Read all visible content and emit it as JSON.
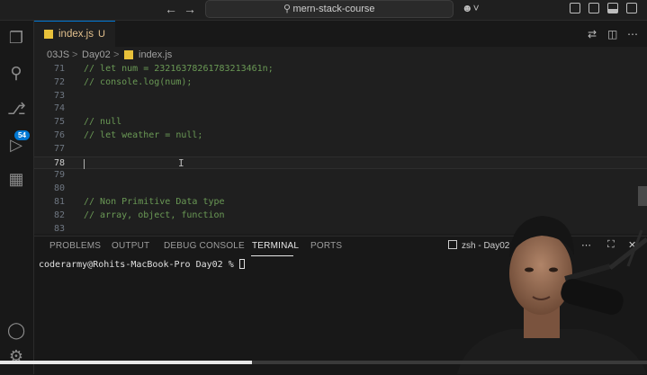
{
  "titlebar": {
    "back_icon": "arrow-left-icon",
    "forward_icon": "arrow-right-icon",
    "search_text": "mern-stack-course",
    "copilot_icon": "copilot-icon",
    "layout_icons": [
      "layout-panel-icon",
      "toggle-primary-sidebar-icon",
      "toggle-panel-icon",
      "toggle-secondary-sidebar-icon",
      "customize-layout-icon"
    ]
  },
  "activity_bar": {
    "items": [
      "explorer-icon",
      "search-icon",
      "source-control-icon",
      "run-debug-icon",
      "extensions-icon"
    ],
    "source_control_badge": "54",
    "bottom": [
      "account-icon",
      "manage-gear-icon"
    ]
  },
  "tab": {
    "label": "index.js",
    "status": "U",
    "close_icon": "close-icon"
  },
  "tab_actions": [
    "compare-changes-icon",
    "split-editor-icon",
    "more-actions-icon"
  ],
  "breadcrumb": {
    "folder1": "03JS",
    "folder2": "Day02",
    "file": "index.js",
    "sep": ">"
  },
  "editor": {
    "lines": [
      {
        "num": "71",
        "code": "// let num = 23216378261783213461n;"
      },
      {
        "num": "72",
        "code": "// console.log(num);"
      },
      {
        "num": "73",
        "code": ""
      },
      {
        "num": "74",
        "code": ""
      },
      {
        "num": "75",
        "code": "// null"
      },
      {
        "num": "76",
        "code": "// let weather = null;"
      },
      {
        "num": "77",
        "code": ""
      },
      {
        "num": "78",
        "code": ""
      },
      {
        "num": "79",
        "code": ""
      },
      {
        "num": "80",
        "code": ""
      },
      {
        "num": "81",
        "code": "// Non Primitive Data type"
      },
      {
        "num": "82",
        "code": "// array, object, function"
      },
      {
        "num": "83",
        "code": ""
      }
    ],
    "active_line": "78",
    "ibeam": "I"
  },
  "panel": {
    "tabs": [
      "PROBLEMS",
      "OUTPUT",
      "DEBUG CONSOLE",
      "TERMINAL",
      "PORTS"
    ],
    "active_tab": "TERMINAL",
    "terminal_name": "zsh - Day02",
    "prompt": "coderarmy@Rohits-MacBook-Pro Day02 % "
  },
  "video": {
    "progress_fraction": 0.39
  },
  "colors": {
    "accent": "#0078d4",
    "comment": "#6a9955",
    "js_icon": "#e8c13a",
    "modified": "#e2c08d"
  }
}
